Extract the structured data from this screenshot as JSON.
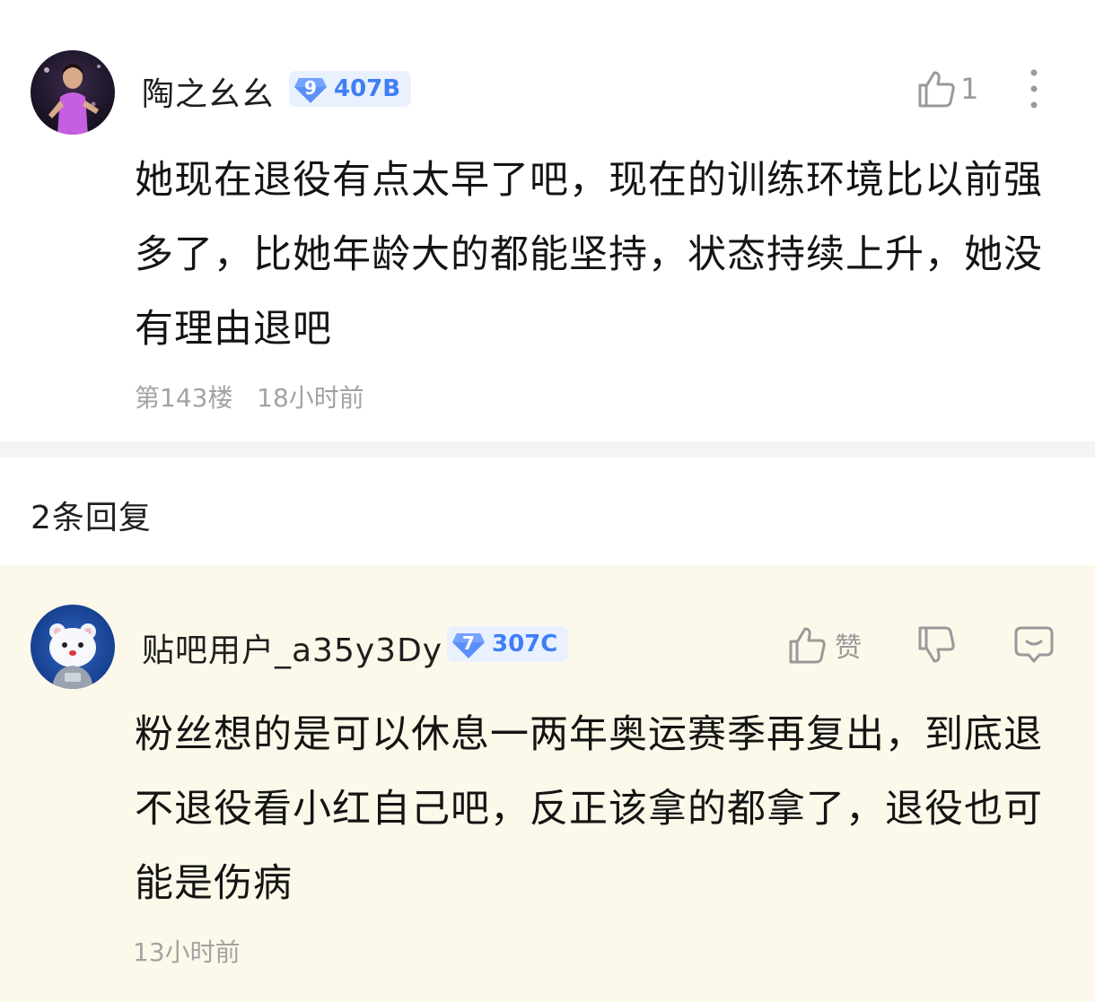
{
  "post": {
    "username": "陶之幺幺",
    "level": "9",
    "tier": "407B",
    "like_count": "1",
    "content": "她现在退役有点太早了吧，现在的训练环境比以前强多了，比她年龄大的都能坚持，状态持续上升，她没有理由退吧",
    "floor": "第143楼",
    "time": "18小时前",
    "icons": {
      "like": "thumbs-up-icon",
      "more": "more-vertical-icon"
    }
  },
  "replies_header": "2条回复",
  "reply": {
    "username": "贴吧用户_a35y3Dy",
    "level": "7",
    "tier": "307C",
    "like_label": "赞",
    "content": "粉丝想的是可以休息一两年奥运赛季再复出，到底退不退役看小红自己吧，反正该拿的都拿了，退役也可能是伤病",
    "time": "13小时前",
    "icons": {
      "like": "thumbs-up-icon",
      "dislike": "thumbs-down-icon",
      "comment": "comment-icon"
    }
  },
  "colors": {
    "reply_background": "#fcf9ea",
    "level_badge": "#5b8ff9",
    "tier_text": "#3f7ef5",
    "muted_text": "#a3a3a3"
  }
}
